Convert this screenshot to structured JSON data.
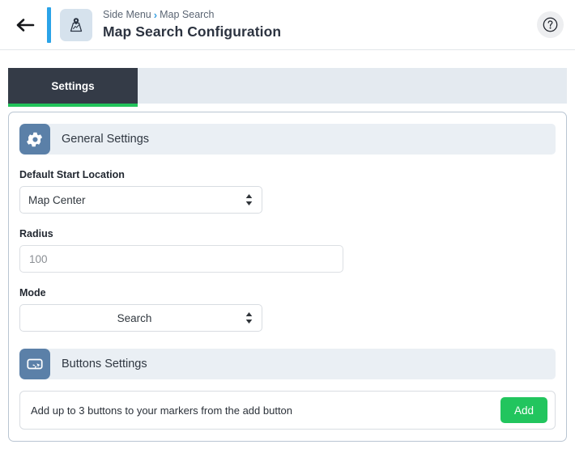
{
  "header": {
    "back_icon": "arrow-left-icon",
    "app_icon": "map-pin-icon",
    "breadcrumb": {
      "parent": "Side Menu",
      "separator": "›",
      "current": "Map Search"
    },
    "title": "Map Search Configuration",
    "help_icon": "question-circle-icon"
  },
  "tabs": [
    {
      "label": "Settings",
      "active": true
    }
  ],
  "sections": [
    {
      "id": "general-settings",
      "icon": "gear-icon",
      "title": "General Settings",
      "fields": [
        {
          "id": "default-start-location",
          "label": "Default Start Location",
          "type": "select",
          "value": "Map Center",
          "align": "left"
        },
        {
          "id": "radius",
          "label": "Radius",
          "type": "text",
          "value": "",
          "placeholder": "100"
        },
        {
          "id": "mode",
          "label": "Mode",
          "type": "select",
          "value": "Search",
          "align": "center"
        }
      ]
    },
    {
      "id": "buttons-settings",
      "icon": "button-click-icon",
      "title": "Buttons Settings",
      "info_text": "Add up to 3 buttons to your markers from the add button",
      "add_label": "Add"
    }
  ],
  "colors": {
    "accent_blue": "#2aa3e8",
    "tab_active_bg": "#343b47",
    "tab_underline_green": "#21c35a",
    "add_button_green": "#22c55e",
    "section_icon_blue": "#5b80a8",
    "section_head_bg": "#eaeff4",
    "tabbar_bg": "#e4eaf0"
  }
}
